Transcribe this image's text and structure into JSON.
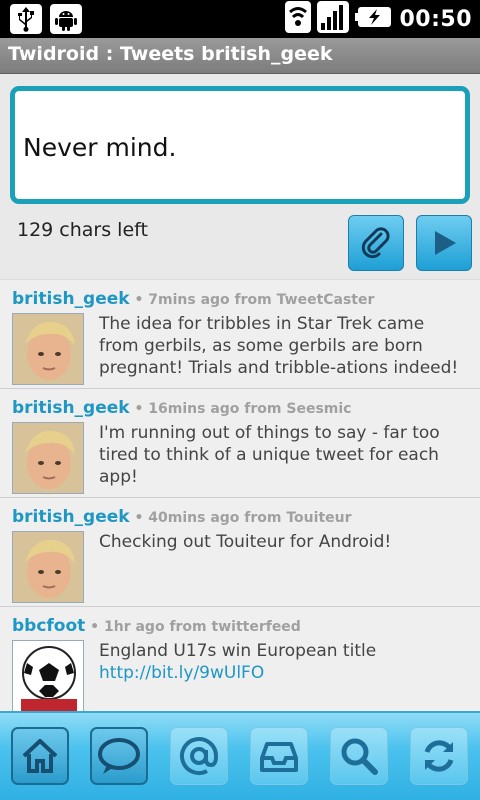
{
  "status_bar": {
    "time": "00:50",
    "icons": [
      "usb-icon",
      "android-icon",
      "wifi-icon",
      "signal-icon",
      "battery-charging-icon"
    ]
  },
  "title_bar": {
    "title": "Twidroid : Tweets british_geek"
  },
  "compose": {
    "text": "Never mind.",
    "chars_left": "129 chars left",
    "attach_icon": "paperclip-icon",
    "send_icon": "play-icon"
  },
  "tweets": [
    {
      "user": "british_geek",
      "meta": " • 7mins ago from TweetCaster",
      "text": "The idea for tribbles in Star Trek came from gerbils, as some gerbils are born pregnant! Trials and tribble-ations indeed!",
      "link": ""
    },
    {
      "user": "british_geek",
      "meta": " • 16mins ago from Seesmic",
      "text": "I'm running out of things to say - far too tired to think of a unique tweet for each app!",
      "link": ""
    },
    {
      "user": "british_geek",
      "meta": " • 40mins ago from Touiteur",
      "text": "Checking out Touiteur for Android!",
      "link": ""
    },
    {
      "user": "bbcfoot",
      "meta": " • 1hr ago from twitterfeed",
      "text": "England U17s win European title ",
      "link": "http://bit.ly/9wUlFO"
    }
  ],
  "toolbar": {
    "buttons": [
      "home-icon",
      "speech-bubble-icon",
      "at-sign-icon",
      "inbox-icon",
      "search-icon",
      "refresh-icon"
    ]
  },
  "colors": {
    "accent": "#1aa0b8",
    "username": "#1e97c4",
    "toolbar": "#4cc2ee"
  }
}
